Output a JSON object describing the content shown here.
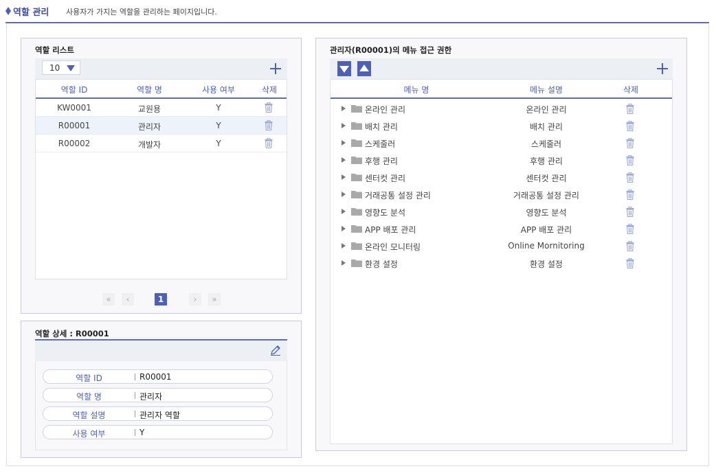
{
  "header": {
    "title": "역할 관리",
    "description": "사용자가 가지는 역할을 관리하는 페이지입니다."
  },
  "role_list": {
    "title": "역할 리스트",
    "page_size": "10",
    "columns": [
      "역할 ID",
      "역할 명",
      "사용 여부",
      "삭제"
    ],
    "rows": [
      {
        "id": "KW0001",
        "name": "교원용",
        "use": "Y"
      },
      {
        "id": "R00001",
        "name": "관리자",
        "use": "Y"
      },
      {
        "id": "R00002",
        "name": "개발자",
        "use": "Y"
      }
    ],
    "selected_row": 1,
    "pagination": {
      "first": "«",
      "prev": "‹",
      "current": "1",
      "next": "›",
      "last": "»"
    }
  },
  "role_detail": {
    "title": "역할 상세 : R00001",
    "fields": [
      {
        "label": "역할 ID",
        "value": "R00001"
      },
      {
        "label": "역할 명",
        "value": "관리자"
      },
      {
        "label": "역할 설명",
        "value": "관리자 역할"
      },
      {
        "label": "사용 여부",
        "value": "Y"
      }
    ]
  },
  "menu_access": {
    "title": "관리자(R00001)의 메뉴 접근 권한",
    "columns": [
      "메뉴 명",
      "메뉴 설명",
      "삭제"
    ],
    "rows": [
      {
        "name": "온라인 관리",
        "desc": "온라인 관리"
      },
      {
        "name": "배치 관리",
        "desc": "배치 관리"
      },
      {
        "name": "스케줄러",
        "desc": "스케줄러"
      },
      {
        "name": "후행 관리",
        "desc": "후행 관리"
      },
      {
        "name": "센터컷 관리",
        "desc": "센터컷 관리"
      },
      {
        "name": "거래공통 설정 관리",
        "desc": "거래공통 설정 관리"
      },
      {
        "name": "영향도 분석",
        "desc": "영향도 분석"
      },
      {
        "name": "APP 배포 관리",
        "desc": "APP 배포 관리"
      },
      {
        "name": "온라인 모니터링",
        "desc": "Online Mornitoring"
      },
      {
        "name": "환경 설정",
        "desc": "환경 설정"
      }
    ]
  },
  "colors": {
    "accent": "#4d5fb7",
    "header_rule": "#5b6bb5",
    "icon_light": "#9aa6d8"
  }
}
